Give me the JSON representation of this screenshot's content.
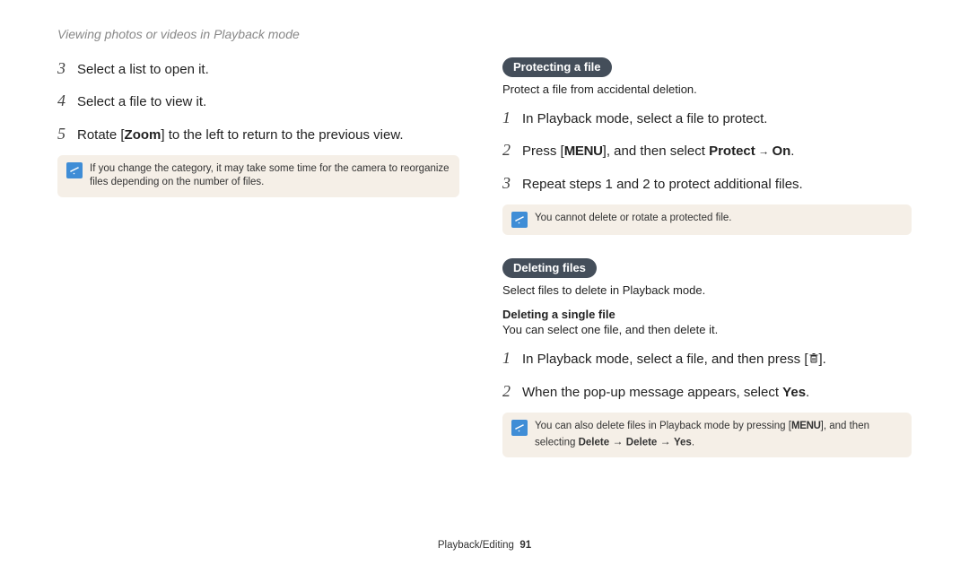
{
  "header": {
    "title": "Viewing photos or videos in Playback mode"
  },
  "left": {
    "steps": {
      "a": {
        "n": "3",
        "text": "Select a list to open it."
      },
      "b": {
        "n": "4",
        "text": "Select a file to view it."
      },
      "c": {
        "n": "5",
        "prefix": "Rotate [",
        "bold": "Zoom",
        "suffix": "] to the left to return to the previous view."
      }
    },
    "note": "If you change the category, it may take some time for the camera to reorganize files depending on the number of files."
  },
  "right": {
    "protect": {
      "pill": "Protecting a file",
      "sub": "Protect a file from accidental deletion.",
      "steps": {
        "a": {
          "n": "1",
          "text": "In Playback mode, select a file to protect."
        },
        "b": {
          "n": "2",
          "p1": "Press [",
          "menu": "MENU",
          "p2": "], and then select ",
          "bold1": "Protect",
          "arrow": " → ",
          "bold2": "On",
          "p3": "."
        },
        "c": {
          "n": "3",
          "text": "Repeat steps 1 and 2 to protect additional files."
        }
      },
      "note": "You cannot delete or rotate a protected file."
    },
    "delete": {
      "pill": "Deleting files",
      "sub": "Select files to delete in Playback mode.",
      "subhead": "Deleting a single file",
      "subdesc": "You can select one file, and then delete it.",
      "steps": {
        "a": {
          "n": "1",
          "p1": "In Playback mode, select a file, and then press [",
          "p2": "]."
        },
        "b": {
          "n": "2",
          "p1": "When the pop-up message appears, select ",
          "bold": "Yes",
          "p2": "."
        }
      },
      "note": {
        "p1": "You can also delete files in Playback mode by pressing [",
        "menu": "MENU",
        "p2": "], and then selecting ",
        "b1": "Delete",
        "a1": " → ",
        "b2": "Delete",
        "a2": " → ",
        "b3": "Yes",
        "p3": "."
      }
    }
  },
  "footer": {
    "section": "Playback/Editing",
    "page": "91"
  }
}
